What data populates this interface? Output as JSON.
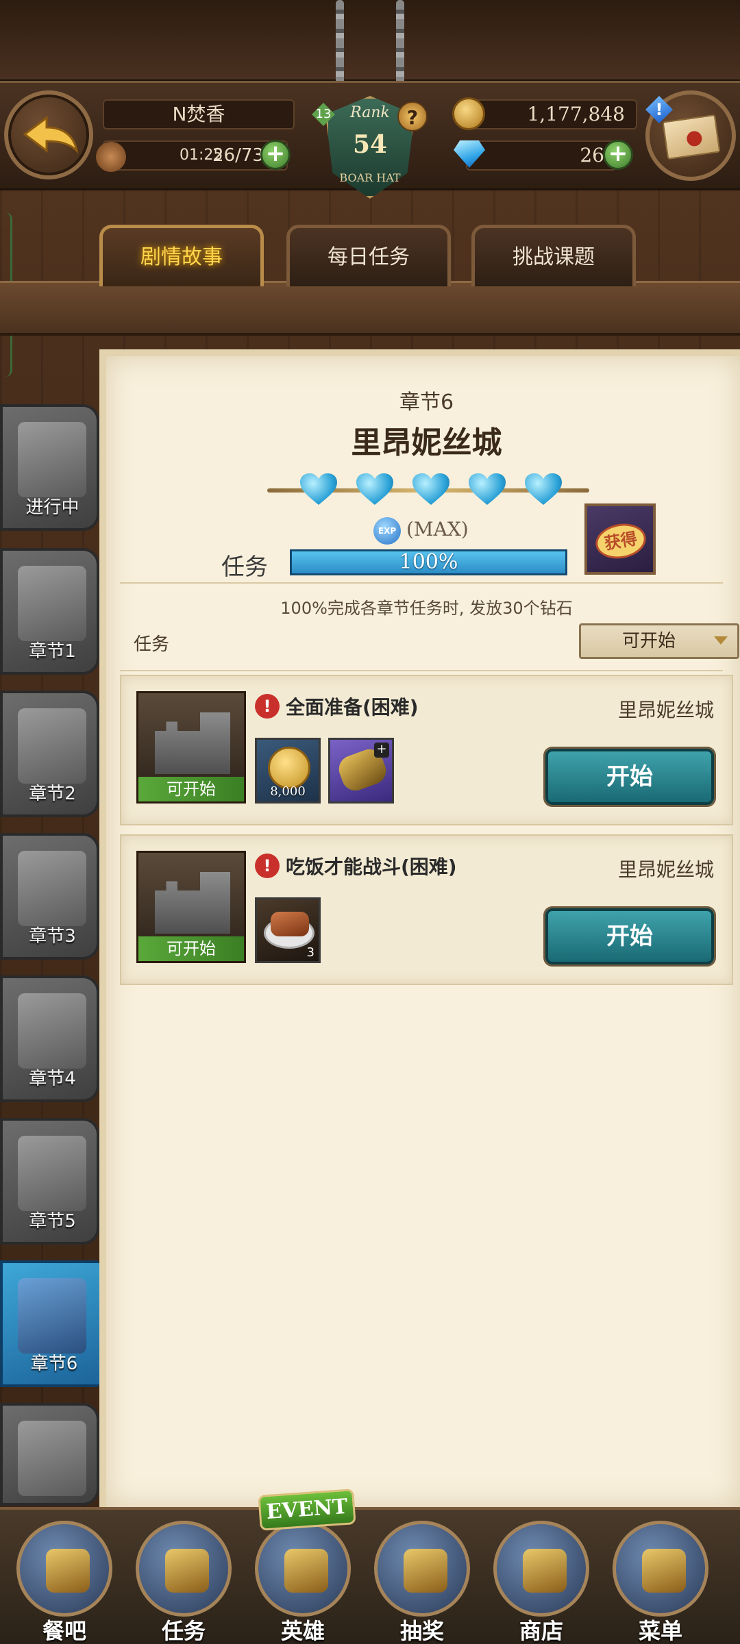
{
  "header": {
    "player_name": "N焚香",
    "stamina_time": "01:25",
    "stamina_value": "26/73",
    "rank_label": "Rank",
    "rank_value": "54",
    "rank_level": "13",
    "rank_subtitle": "BOAR HAT",
    "gold": "1,177,848",
    "gems": "26",
    "mail_alert": "!"
  },
  "tabs": [
    {
      "label": "剧情故事",
      "active": true
    },
    {
      "label": "每日任务",
      "active": false
    },
    {
      "label": "挑战课题",
      "active": false
    }
  ],
  "sidebar": {
    "items": [
      {
        "label": "进行中"
      },
      {
        "label": "章节1"
      },
      {
        "label": "章节2"
      },
      {
        "label": "章节3"
      },
      {
        "label": "章节4"
      },
      {
        "label": "章节5"
      },
      {
        "label": "章节6",
        "active": true
      },
      {
        "label": ""
      }
    ]
  },
  "chapter": {
    "number": "章节6",
    "title": "里昂妮丝城",
    "hearts_filled": 5,
    "exp_icon": "EXP",
    "exp_status": "(MAX)",
    "mission_label": "任务",
    "progress_text": "100%",
    "progress_fraction": 1.0,
    "reward_badge": "获得",
    "reward_note": "100%完成各章节任务时, 发放30个钻石"
  },
  "filter": {
    "label": "任务",
    "selected": "可开始"
  },
  "quests": [
    {
      "status": "可开始",
      "alert": "!",
      "title": "全面准备(困难)",
      "location": "里昂妮丝城",
      "coin_amount": "8,000",
      "start_label": "开始"
    },
    {
      "status": "可开始",
      "alert": "!",
      "title": "吃饭才能战斗(困难)",
      "location": "里昂妮丝城",
      "food_qty": "3",
      "start_label": "开始"
    }
  ],
  "bottom_nav": {
    "event_badge": "EVENT",
    "items": [
      {
        "label": "餐吧",
        "icon": "tavern-icon"
      },
      {
        "label": "任务",
        "icon": "scroll-icon"
      },
      {
        "label": "英雄",
        "icon": "helmet-icon"
      },
      {
        "label": "抽奖",
        "icon": "crystal-icon"
      },
      {
        "label": "商店",
        "icon": "shop-icon"
      },
      {
        "label": "菜单",
        "icon": "gear-icon"
      }
    ]
  },
  "colors": {
    "tab_active_text": "#ffd54d",
    "start_button": "#2a8a94",
    "status_green": "#5aa83a",
    "progress_blue": "#2c8dc6"
  }
}
